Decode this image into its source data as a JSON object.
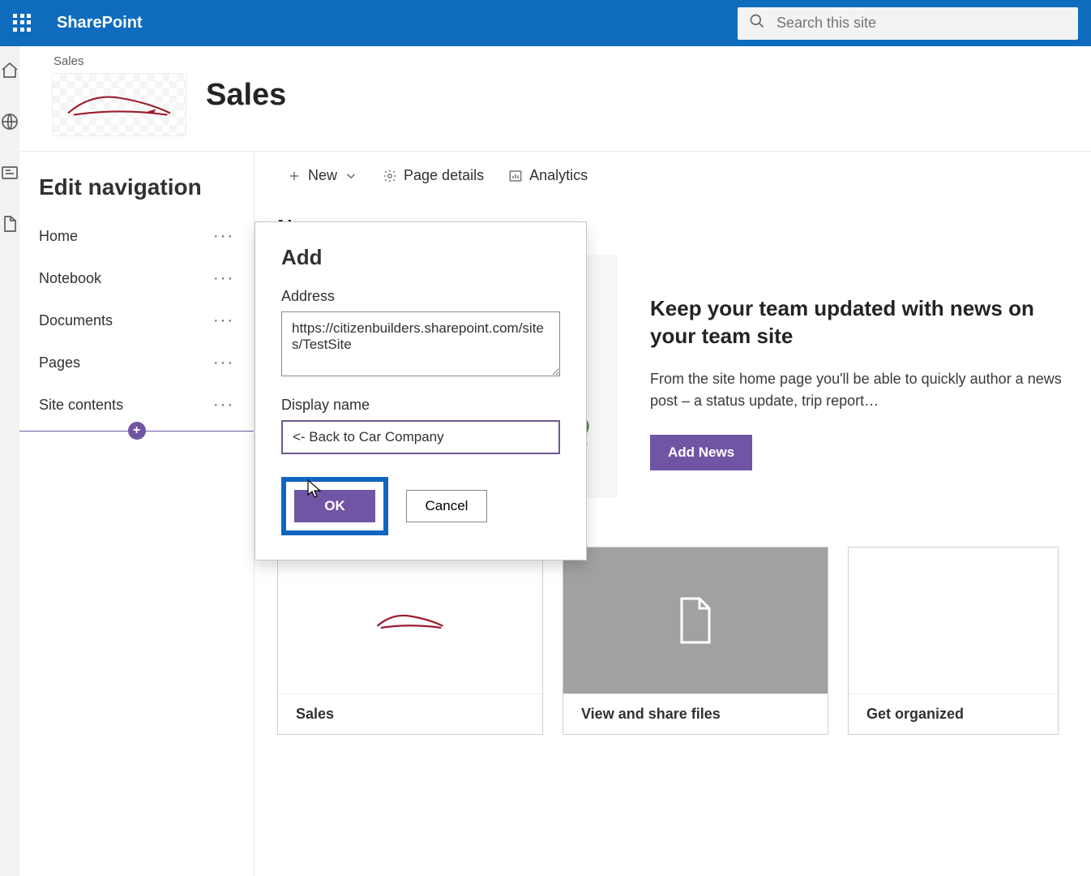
{
  "suite": {
    "app_name": "SharePoint",
    "search_placeholder": "Search this site"
  },
  "site": {
    "breadcrumb": "Sales",
    "title": "Sales"
  },
  "nav_panel": {
    "title": "Edit navigation",
    "items": [
      "Home",
      "Notebook",
      "Documents",
      "Pages",
      "Site contents"
    ]
  },
  "commands": {
    "new": "New",
    "details": "Page details",
    "analytics": "Analytics"
  },
  "news": {
    "section_title": "News",
    "heading": "Keep your team updated with news on your team site",
    "body": "From the site home page you'll be able to quickly author a news post – a status update, trip report…",
    "button": "Add News"
  },
  "cards": [
    {
      "title": "Sales",
      "thumb": "car"
    },
    {
      "title": "View and share files",
      "thumb": "doc"
    },
    {
      "title": "Get organized",
      "thumb": "blank"
    }
  ],
  "add_popup": {
    "title": "Add",
    "address_label": "Address",
    "address_value": "https://citizenbuilders.sharepoint.com/sites/TestSite",
    "display_label": "Display name",
    "display_value": "<- Back to Car Company",
    "ok": "OK",
    "cancel": "Cancel"
  }
}
